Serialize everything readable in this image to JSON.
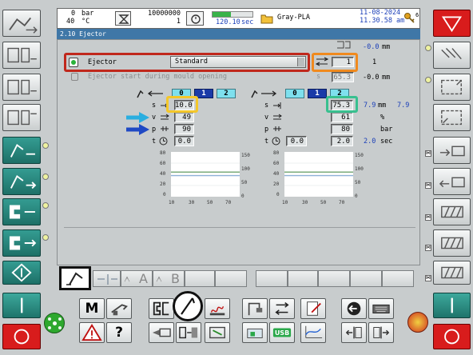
{
  "header": {
    "pressure_value": "0",
    "pressure_unit": "bar",
    "temp_value": "40",
    "temp_unit": "°C",
    "counter_top": "10000000",
    "counter_bottom": "1",
    "cycle_time": "120.10",
    "cycle_unit": "sec",
    "cycle_progress": 0.45,
    "mold_name": "Gray-PLA",
    "date": "11-08-2024",
    "time": "11.30.58 am",
    "key_number": "6"
  },
  "screen": {
    "title": "2.10 Ejector"
  },
  "ejector": {
    "top_position_value": "-0.0",
    "top_position_unit": "mm",
    "label": "Ejector",
    "mode": "Standard",
    "pulse_count": "1",
    "pulse_count_display": "1",
    "start_label": "Ejector start during mould opening",
    "start_s_label": "s",
    "start_s_value": "65.3",
    "start_value": "-0.0",
    "start_unit": "mm"
  },
  "retract": {
    "tabs": [
      "0",
      "1",
      "2"
    ],
    "selected_tab": "1",
    "s_label": "s",
    "s_value": "10.0",
    "v_label": "v",
    "v_value": "49",
    "p_label": "p",
    "p_value": "90",
    "t_label": "t",
    "t_value": "0.0"
  },
  "forward": {
    "tabs": [
      "0",
      "1",
      "2"
    ],
    "selected_tab": "1",
    "s_label": "s",
    "s_value": "75.3",
    "s_actual": "7.9",
    "s_unit": "mm",
    "s_actual2": "7.9",
    "v_label": "v",
    "v_value": "61",
    "v_unit": "%",
    "p_label": "p",
    "p_value": "80",
    "p_unit": "bar",
    "t_label": "t",
    "t_value_a": "0.0",
    "t_value_b": "2.0",
    "t_actual": "2.0",
    "t_unit": "sec"
  },
  "chart_left": {
    "x_ticks": [
      "10",
      "30",
      "50",
      "70"
    ],
    "y_left_ticks": [
      "80",
      "60",
      "40",
      "20",
      "0"
    ],
    "y_right_ticks": [
      "150",
      "100",
      "50",
      "0"
    ]
  },
  "chart_right": {
    "x_ticks": [
      "10",
      "30",
      "50",
      "70"
    ],
    "y_left_ticks": [
      "80",
      "60",
      "40",
      "20",
      "0"
    ],
    "y_right_ticks": [
      "150",
      "100",
      "50",
      "0"
    ]
  },
  "chart_data": [
    {
      "type": "line",
      "title": "",
      "xlim": [
        0,
        80
      ],
      "ylim": [
        0,
        100
      ],
      "y2lim": [
        0,
        150
      ],
      "series": [
        {
          "color": "#4f8f4f",
          "x": [
            0,
            80
          ],
          "y": [
            55,
            55
          ]
        },
        {
          "color": "#7da6d3",
          "x": [
            0,
            80
          ],
          "y": [
            47,
            47
          ]
        }
      ]
    },
    {
      "type": "line",
      "title": "",
      "xlim": [
        0,
        80
      ],
      "ylim": [
        0,
        100
      ],
      "y2lim": [
        0,
        150
      ],
      "series": [
        {
          "color": "#4f8f4f",
          "x": [
            0,
            80
          ],
          "y": [
            55,
            55
          ]
        },
        {
          "color": "#7da6d3",
          "x": [
            0,
            80
          ],
          "y": [
            47,
            47
          ]
        }
      ]
    }
  ],
  "bottom_tabs": {
    "tab_a": "A",
    "tab_b": "B"
  },
  "icons": {
    "manual_mode": "M",
    "help": "?",
    "usb": "USB"
  },
  "highlights": {
    "ejector_row": "#c0281c",
    "pulse_count": "#f08a1e",
    "s_retract": "#f4c72a",
    "s_forward": "#38c08f",
    "v_arrow": "#2aaee0",
    "p_arrow": "#1f49c4"
  }
}
